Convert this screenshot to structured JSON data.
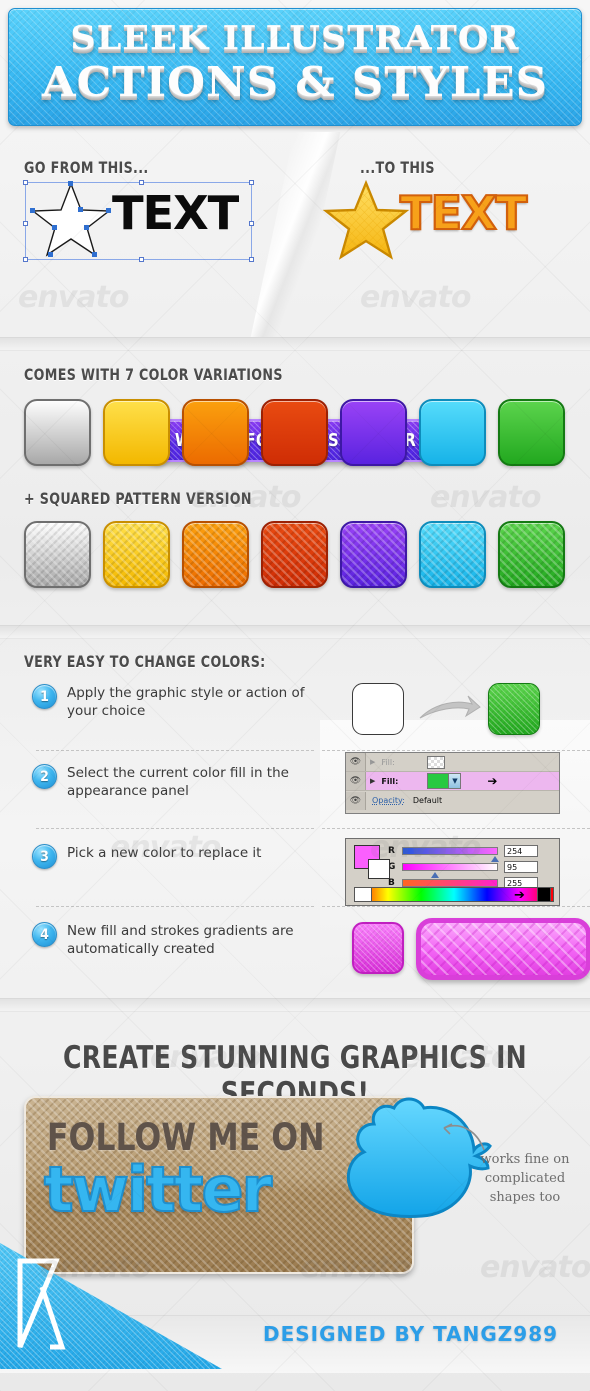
{
  "banner": {
    "line1": "SLEEK ILLUSTRATOR",
    "line2": "ACTIONS & STYLES",
    "bg_color": "#33b4f0"
  },
  "compare": {
    "label_before": "GO FROM THIS...",
    "label_after": "...TO THIS",
    "before_text": "TEXT",
    "after_text": "TEXT",
    "button_label": "WORKS FOR ANY SHAPE OR TEXT",
    "button_color": "#6a32ef"
  },
  "colors_section": {
    "heading": "COMES WITH 7 COLOR VARIATIONS",
    "pattern_heading": "+ SQUARED PATTERN VERSION",
    "swatches": [
      {
        "name": "silver",
        "top": "#fdfdfd",
        "bottom": "#a8a8a8",
        "border": "#6f6f6f"
      },
      {
        "name": "yellow",
        "top": "#ffe04a",
        "bottom": "#f3b800",
        "border": "#c98f00"
      },
      {
        "name": "orange",
        "top": "#fba00e",
        "bottom": "#ec6b00",
        "border": "#b85000"
      },
      {
        "name": "red",
        "top": "#e94b11",
        "bottom": "#cf2d05",
        "border": "#9c2104"
      },
      {
        "name": "purple",
        "top": "#9a43f6",
        "bottom": "#5a23e0",
        "border": "#3d18a5"
      },
      {
        "name": "cyan",
        "top": "#56dcfb",
        "bottom": "#17b3e8",
        "border": "#0d8cbb"
      },
      {
        "name": "green",
        "top": "#5cd44d",
        "bottom": "#22a81f",
        "border": "#147a13"
      }
    ]
  },
  "steps_section": {
    "heading": "VERY EASY TO CHANGE COLORS:",
    "steps": [
      {
        "num": "1",
        "text": "Apply  the graphic style or action of your choice"
      },
      {
        "num": "2",
        "text": "Select the current color fill in the appearance panel"
      },
      {
        "num": "3",
        "text": "Pick a new color to replace it"
      },
      {
        "num": "4",
        "text": "New fill and strokes gradients are automatically created"
      }
    ],
    "appearance_panel": {
      "row1_label": "Fill:",
      "row2_label": "Fill:",
      "opacity_label": "Opacity:",
      "opacity_value": "Default",
      "fill_color": "#28c942",
      "highlight_color": "#edb7ef"
    },
    "color_picker": {
      "swatch_color": "#fb5ffe",
      "channels": [
        {
          "label": "R",
          "value": "254"
        },
        {
          "label": "G",
          "value": "95"
        },
        {
          "label": "B",
          "value": "255"
        }
      ]
    },
    "result_color": "#e84be8"
  },
  "cta": {
    "headline": "CREATE STUNNING GRAPHICS IN SECONDS!",
    "twitter_line1": "FOLLOW ME ON",
    "twitter_line2": "twitter",
    "note": "works fine on complicated shapes too"
  },
  "footer": {
    "credit": "DESIGNED BY TANGZ989",
    "accent_color": "#2c9ee8"
  },
  "watermarks": [
    "envato",
    "envato",
    "envato",
    "envato",
    "envato",
    "envato",
    "envato",
    "envato"
  ]
}
